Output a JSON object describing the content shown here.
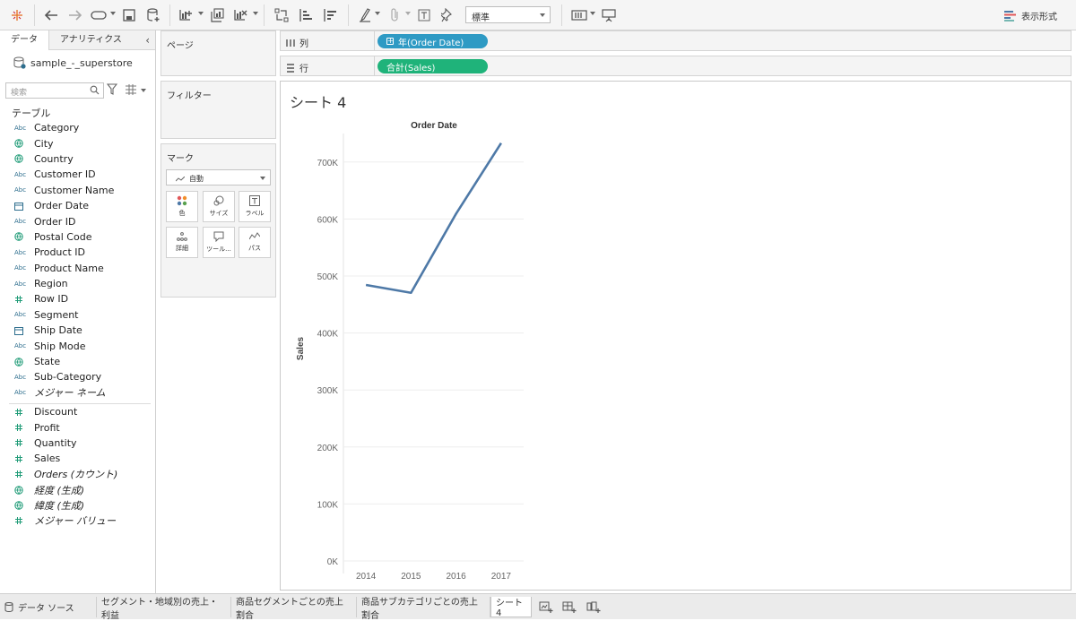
{
  "toolbar": {
    "style_select": "標準",
    "show_me": "表示形式"
  },
  "data_pane": {
    "tabs": [
      "データ",
      "アナリティクス"
    ],
    "data_source": "sample_-_superstore",
    "search_placeholder": "検索",
    "tables_label": "テーブル",
    "dimensions": [
      {
        "type": "Abc",
        "name": "Category"
      },
      {
        "type": "geo",
        "name": "City"
      },
      {
        "type": "geo",
        "name": "Country"
      },
      {
        "type": "Abc",
        "name": "Customer ID"
      },
      {
        "type": "Abc",
        "name": "Customer Name"
      },
      {
        "type": "date",
        "name": "Order Date"
      },
      {
        "type": "Abc",
        "name": "Order ID"
      },
      {
        "type": "geo",
        "name": "Postal Code"
      },
      {
        "type": "Abc",
        "name": "Product ID"
      },
      {
        "type": "Abc",
        "name": "Product Name"
      },
      {
        "type": "Abc",
        "name": "Region"
      },
      {
        "type": "num",
        "name": "Row ID"
      },
      {
        "type": "Abc",
        "name": "Segment"
      },
      {
        "type": "date",
        "name": "Ship Date"
      },
      {
        "type": "Abc",
        "name": "Ship Mode"
      },
      {
        "type": "geo",
        "name": "State"
      },
      {
        "type": "Abc",
        "name": "Sub-Category"
      },
      {
        "type": "Abc",
        "name": "メジャー ネーム",
        "italic": true
      }
    ],
    "measures": [
      {
        "type": "num",
        "name": "Discount"
      },
      {
        "type": "num",
        "name": "Profit"
      },
      {
        "type": "num",
        "name": "Quantity"
      },
      {
        "type": "num",
        "name": "Sales"
      },
      {
        "type": "num",
        "name": "Orders (カウント)",
        "italic": true
      },
      {
        "type": "geo",
        "name": "経度 (生成)",
        "italic": true
      },
      {
        "type": "geo",
        "name": "緯度 (生成)",
        "italic": true
      },
      {
        "type": "num",
        "name": "メジャー バリュー",
        "italic": true
      }
    ]
  },
  "cards": {
    "pages": "ページ",
    "filters": "フィルター",
    "marks": "マーク",
    "marks_type": "自動",
    "mark_buttons": [
      "色",
      "サイズ",
      "ラベル",
      "詳細",
      "ツール...",
      "パス"
    ]
  },
  "shelves": {
    "columns_label": "列",
    "columns_pill": "年(Order Date)",
    "rows_label": "行",
    "rows_pill": "合計(Sales)"
  },
  "sheet": {
    "title": "シート 4"
  },
  "chart_data": {
    "type": "line",
    "title": "Order Date",
    "xlabel": "",
    "ylabel": "Sales",
    "categories": [
      "2014",
      "2015",
      "2016",
      "2017"
    ],
    "values": [
      484247,
      470533,
      609206,
      733215
    ],
    "ylim": [
      0,
      750000
    ],
    "yticks": [
      0,
      100000,
      200000,
      300000,
      400000,
      500000,
      600000,
      700000
    ],
    "ytick_labels": [
      "0K",
      "100K",
      "200K",
      "300K",
      "400K",
      "500K",
      "600K",
      "700K"
    ],
    "line_color": "#4e79a7",
    "grid": true
  },
  "bottom_tabs": {
    "data_source": "データ ソース",
    "sheets": [
      "セグメント・地域別の売上・利益",
      "商品セグメントごとの売上割合",
      "商品サブカテゴリごとの売上割合",
      "シート 4"
    ]
  },
  "colors": {
    "columns_pill": "#2e9ac4",
    "rows_pill": "#1fb37a"
  }
}
